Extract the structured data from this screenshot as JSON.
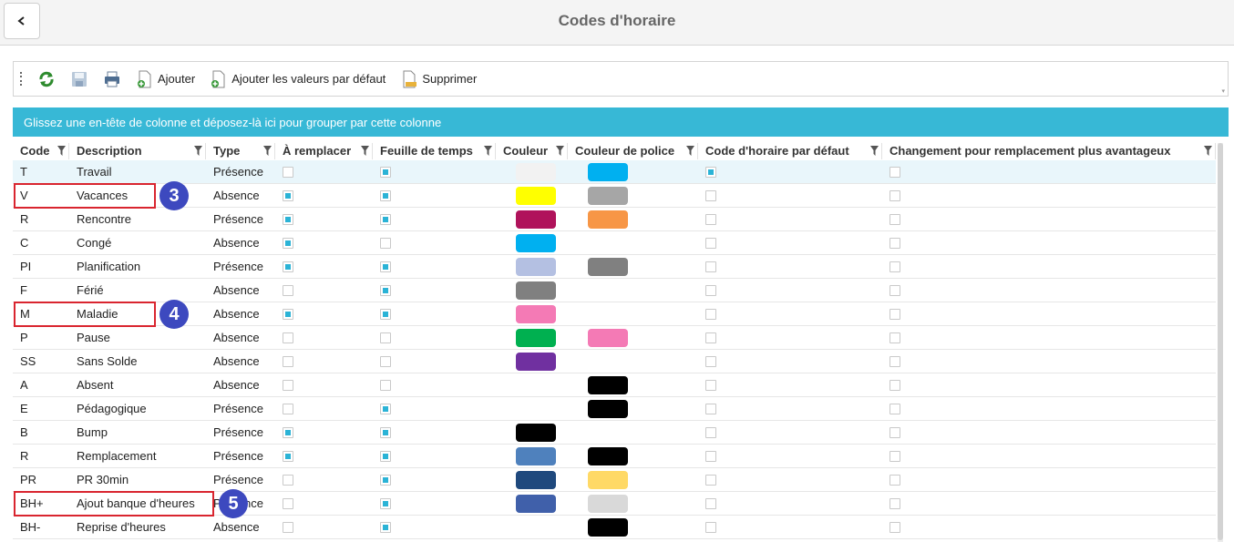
{
  "title": "Codes d'horaire",
  "toolbar": {
    "buttons": [
      {
        "icon": "refresh-icon",
        "label": ""
      },
      {
        "icon": "save-icon",
        "label": ""
      },
      {
        "icon": "print-icon",
        "label": ""
      },
      {
        "icon": "add-document-icon",
        "label": "Ajouter"
      },
      {
        "icon": "add-document-icon",
        "label": "Ajouter les valeurs par défaut"
      },
      {
        "icon": "delete-document-icon",
        "label": "Supprimer"
      }
    ]
  },
  "group_panel": "Glissez une en-tête de colonne et déposez-là ici pour grouper par cette colonne",
  "columns": [
    "Code",
    "Description",
    "Type",
    "À remplacer",
    "Feuille de temps",
    "Couleur",
    "Couleur de police",
    "Code d'horaire par défaut",
    "Changement pour remplacement plus avantageux"
  ],
  "rows": [
    {
      "code": "T",
      "description": "Travail",
      "type": "Présence",
      "a_remplacer": false,
      "feuille": true,
      "couleur": "#f2f2f2",
      "police": "#00b0f0",
      "defaut": true,
      "changement": false
    },
    {
      "code": "V",
      "description": "Vacances",
      "type": "Absence",
      "a_remplacer": true,
      "feuille": true,
      "couleur": "#ffff00",
      "police": "#a6a6a6",
      "defaut": false,
      "changement": false
    },
    {
      "code": "R",
      "description": "Rencontre",
      "type": "Présence",
      "a_remplacer": true,
      "feuille": true,
      "couleur": "#b0135b",
      "police": "#f79646",
      "defaut": false,
      "changement": false
    },
    {
      "code": "C",
      "description": "Congé",
      "type": "Absence",
      "a_remplacer": true,
      "feuille": false,
      "couleur": "#00b0f0",
      "police": "",
      "defaut": false,
      "changement": false
    },
    {
      "code": "PI",
      "description": "Planification",
      "type": "Présence",
      "a_remplacer": true,
      "feuille": true,
      "couleur": "#b4c0e2",
      "police": "#808080",
      "defaut": false,
      "changement": false
    },
    {
      "code": "F",
      "description": "Férié",
      "type": "Absence",
      "a_remplacer": false,
      "feuille": true,
      "couleur": "#808080",
      "police": "",
      "defaut": false,
      "changement": false
    },
    {
      "code": "M",
      "description": "Maladie",
      "type": "Absence",
      "a_remplacer": true,
      "feuille": true,
      "couleur": "#f47ab5",
      "police": "",
      "defaut": false,
      "changement": false
    },
    {
      "code": "P",
      "description": "Pause",
      "type": "Absence",
      "a_remplacer": false,
      "feuille": false,
      "couleur": "#00b050",
      "police": "#f47ab5",
      "defaut": false,
      "changement": false
    },
    {
      "code": "SS",
      "description": "Sans Solde",
      "type": "Absence",
      "a_remplacer": false,
      "feuille": false,
      "couleur": "#7030a0",
      "police": "",
      "defaut": false,
      "changement": false
    },
    {
      "code": "A",
      "description": "Absent",
      "type": "Absence",
      "a_remplacer": false,
      "feuille": false,
      "couleur": "",
      "police": "#000000",
      "defaut": false,
      "changement": false
    },
    {
      "code": "E",
      "description": "Pédagogique",
      "type": "Présence",
      "a_remplacer": false,
      "feuille": true,
      "couleur": "",
      "police": "#000000",
      "defaut": false,
      "changement": false
    },
    {
      "code": "B",
      "description": "Bump",
      "type": "Présence",
      "a_remplacer": true,
      "feuille": true,
      "couleur": "#000000",
      "police": "",
      "defaut": false,
      "changement": false
    },
    {
      "code": "R",
      "description": "Remplacement",
      "type": "Présence",
      "a_remplacer": true,
      "feuille": true,
      "couleur": "#4f81bd",
      "police": "#000000",
      "defaut": false,
      "changement": false
    },
    {
      "code": "PR",
      "description": "PR 30min",
      "type": "Présence",
      "a_remplacer": false,
      "feuille": true,
      "couleur": "#1f497d",
      "police": "#ffd966",
      "defaut": false,
      "changement": false
    },
    {
      "code": "BH+",
      "description": "Ajout banque d'heures",
      "type": "Présence",
      "a_remplacer": false,
      "feuille": true,
      "couleur": "#4060aa",
      "police": "#d9d9d9",
      "defaut": false,
      "changement": false
    },
    {
      "code": "BH-",
      "description": "Reprise d'heures",
      "type": "Absence",
      "a_remplacer": false,
      "feuille": true,
      "couleur": "",
      "police": "#000000",
      "defaut": false,
      "changement": false
    }
  ],
  "callouts": [
    {
      "row": 1,
      "label": "3"
    },
    {
      "row": 6,
      "label": "4"
    },
    {
      "row": 14,
      "label": "5"
    }
  ],
  "colors": {
    "accent": "#37b8d6",
    "callout_border": "#d9252f",
    "badge": "#3d49bf"
  }
}
